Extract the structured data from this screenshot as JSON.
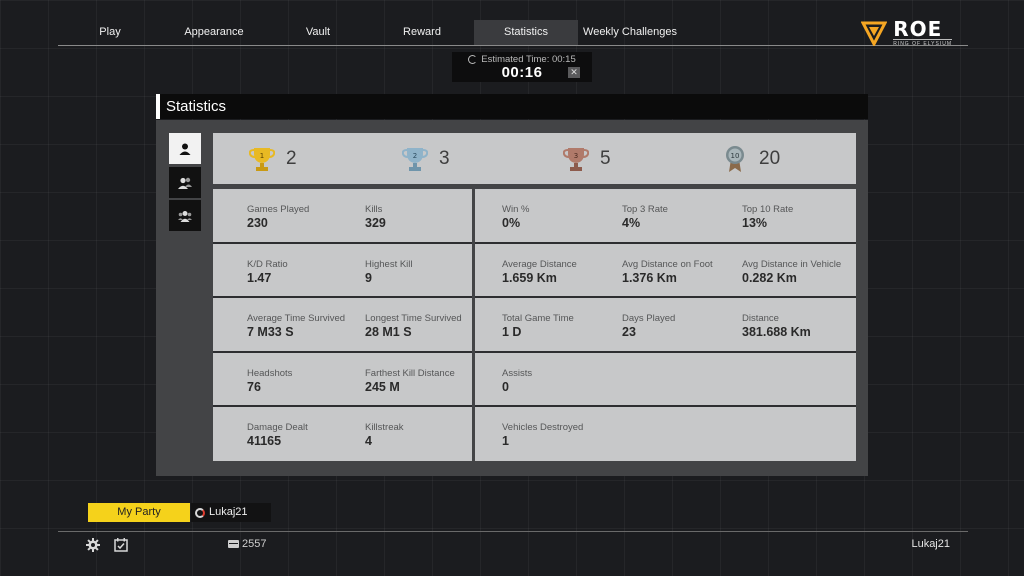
{
  "nav": {
    "tabs": [
      {
        "label": "Play",
        "active": false
      },
      {
        "label": "Appearance",
        "active": false
      },
      {
        "label": "Vault",
        "active": false
      },
      {
        "label": "Reward",
        "active": false
      },
      {
        "label": "Statistics",
        "active": true
      },
      {
        "label": "Weekly Challenges",
        "active": false
      }
    ]
  },
  "logo": {
    "name": "ROE",
    "subtitle": "RING OF ELYSIUM",
    "accent_color": "#f5a623"
  },
  "queue": {
    "estimated_label": "Estimated Time: 00:15",
    "elapsed": "00:16",
    "cancel_symbol": "✕"
  },
  "panel": {
    "title": "Statistics",
    "side_tabs": [
      {
        "icon": "solo-icon",
        "active": true
      },
      {
        "icon": "duo-icon",
        "active": false
      },
      {
        "icon": "squad-icon",
        "active": false
      }
    ]
  },
  "trophies": [
    {
      "icon": "gold-trophy-icon",
      "rank": "1",
      "count": "2",
      "color": "#e8b923"
    },
    {
      "icon": "silver-trophy-icon",
      "rank": "2",
      "count": "3",
      "color": "#8fb3c9"
    },
    {
      "icon": "bronze-trophy-icon",
      "rank": "3",
      "count": "5",
      "color": "#b07a6a"
    },
    {
      "icon": "top10-medal-icon",
      "rank": "10",
      "count": "20",
      "color": "#7a8a8f"
    }
  ],
  "stats_left": [
    [
      {
        "label": "Games Played",
        "value": "230"
      },
      {
        "label": "Kills",
        "value": "329"
      }
    ],
    [
      {
        "label": "K/D Ratio",
        "value": "1.47"
      },
      {
        "label": "Highest Kill",
        "value": "9"
      }
    ],
    [
      {
        "label": "Average Time Survived",
        "value": "7 M33 S"
      },
      {
        "label": "Longest Time Survived",
        "value": "28 M1 S"
      }
    ],
    [
      {
        "label": "Headshots",
        "value": "76"
      },
      {
        "label": "Farthest Kill Distance",
        "value": "245 M"
      }
    ],
    [
      {
        "label": "Damage Dealt",
        "value": "41165"
      },
      {
        "label": "Killstreak",
        "value": "4"
      }
    ]
  ],
  "stats_right": [
    [
      {
        "label": "Win %",
        "value": "0%"
      },
      {
        "label": "Top 3 Rate",
        "value": "4%"
      },
      {
        "label": "Top 10 Rate",
        "value": "13%"
      }
    ],
    [
      {
        "label": "Average Distance",
        "value": "1.659 Km"
      },
      {
        "label": "Avg Distance on Foot",
        "value": "1.376 Km"
      },
      {
        "label": "Avg Distance in Vehicle",
        "value": "0.282 Km"
      }
    ],
    [
      {
        "label": "Total Game Time",
        "value": "1 D"
      },
      {
        "label": "Days Played",
        "value": "23"
      },
      {
        "label": "Distance",
        "value": "381.688 Km"
      }
    ],
    [
      {
        "label": "Assists",
        "value": "0"
      }
    ],
    [
      {
        "label": "Vehicles Destroyed",
        "value": "1"
      }
    ]
  ],
  "party": {
    "button_label": "My Party",
    "member": "Lukaj21",
    "button_color": "#f5d21b"
  },
  "footer": {
    "currency": "2557",
    "username": "Lukaj21"
  }
}
